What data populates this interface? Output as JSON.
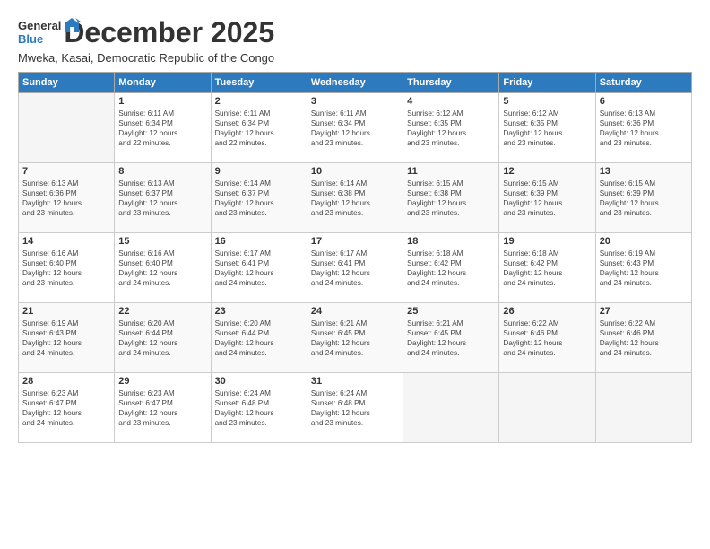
{
  "logo": {
    "line1": "General",
    "line2": "Blue"
  },
  "header": {
    "title": "December 2025",
    "subtitle": "Mweka, Kasai, Democratic Republic of the Congo"
  },
  "days_of_week": [
    "Sunday",
    "Monday",
    "Tuesday",
    "Wednesday",
    "Thursday",
    "Friday",
    "Saturday"
  ],
  "weeks": [
    [
      {
        "day": "",
        "content": ""
      },
      {
        "day": "1",
        "content": "Sunrise: 6:11 AM\nSunset: 6:34 PM\nDaylight: 12 hours\nand 22 minutes."
      },
      {
        "day": "2",
        "content": "Sunrise: 6:11 AM\nSunset: 6:34 PM\nDaylight: 12 hours\nand 22 minutes."
      },
      {
        "day": "3",
        "content": "Sunrise: 6:11 AM\nSunset: 6:34 PM\nDaylight: 12 hours\nand 23 minutes."
      },
      {
        "day": "4",
        "content": "Sunrise: 6:12 AM\nSunset: 6:35 PM\nDaylight: 12 hours\nand 23 minutes."
      },
      {
        "day": "5",
        "content": "Sunrise: 6:12 AM\nSunset: 6:35 PM\nDaylight: 12 hours\nand 23 minutes."
      },
      {
        "day": "6",
        "content": "Sunrise: 6:13 AM\nSunset: 6:36 PM\nDaylight: 12 hours\nand 23 minutes."
      }
    ],
    [
      {
        "day": "7",
        "content": "Sunrise: 6:13 AM\nSunset: 6:36 PM\nDaylight: 12 hours\nand 23 minutes."
      },
      {
        "day": "8",
        "content": "Sunrise: 6:13 AM\nSunset: 6:37 PM\nDaylight: 12 hours\nand 23 minutes."
      },
      {
        "day": "9",
        "content": "Sunrise: 6:14 AM\nSunset: 6:37 PM\nDaylight: 12 hours\nand 23 minutes."
      },
      {
        "day": "10",
        "content": "Sunrise: 6:14 AM\nSunset: 6:38 PM\nDaylight: 12 hours\nand 23 minutes."
      },
      {
        "day": "11",
        "content": "Sunrise: 6:15 AM\nSunset: 6:38 PM\nDaylight: 12 hours\nand 23 minutes."
      },
      {
        "day": "12",
        "content": "Sunrise: 6:15 AM\nSunset: 6:39 PM\nDaylight: 12 hours\nand 23 minutes."
      },
      {
        "day": "13",
        "content": "Sunrise: 6:15 AM\nSunset: 6:39 PM\nDaylight: 12 hours\nand 23 minutes."
      }
    ],
    [
      {
        "day": "14",
        "content": "Sunrise: 6:16 AM\nSunset: 6:40 PM\nDaylight: 12 hours\nand 23 minutes."
      },
      {
        "day": "15",
        "content": "Sunrise: 6:16 AM\nSunset: 6:40 PM\nDaylight: 12 hours\nand 24 minutes."
      },
      {
        "day": "16",
        "content": "Sunrise: 6:17 AM\nSunset: 6:41 PM\nDaylight: 12 hours\nand 24 minutes."
      },
      {
        "day": "17",
        "content": "Sunrise: 6:17 AM\nSunset: 6:41 PM\nDaylight: 12 hours\nand 24 minutes."
      },
      {
        "day": "18",
        "content": "Sunrise: 6:18 AM\nSunset: 6:42 PM\nDaylight: 12 hours\nand 24 minutes."
      },
      {
        "day": "19",
        "content": "Sunrise: 6:18 AM\nSunset: 6:42 PM\nDaylight: 12 hours\nand 24 minutes."
      },
      {
        "day": "20",
        "content": "Sunrise: 6:19 AM\nSunset: 6:43 PM\nDaylight: 12 hours\nand 24 minutes."
      }
    ],
    [
      {
        "day": "21",
        "content": "Sunrise: 6:19 AM\nSunset: 6:43 PM\nDaylight: 12 hours\nand 24 minutes."
      },
      {
        "day": "22",
        "content": "Sunrise: 6:20 AM\nSunset: 6:44 PM\nDaylight: 12 hours\nand 24 minutes."
      },
      {
        "day": "23",
        "content": "Sunrise: 6:20 AM\nSunset: 6:44 PM\nDaylight: 12 hours\nand 24 minutes."
      },
      {
        "day": "24",
        "content": "Sunrise: 6:21 AM\nSunset: 6:45 PM\nDaylight: 12 hours\nand 24 minutes."
      },
      {
        "day": "25",
        "content": "Sunrise: 6:21 AM\nSunset: 6:45 PM\nDaylight: 12 hours\nand 24 minutes."
      },
      {
        "day": "26",
        "content": "Sunrise: 6:22 AM\nSunset: 6:46 PM\nDaylight: 12 hours\nand 24 minutes."
      },
      {
        "day": "27",
        "content": "Sunrise: 6:22 AM\nSunset: 6:46 PM\nDaylight: 12 hours\nand 24 minutes."
      }
    ],
    [
      {
        "day": "28",
        "content": "Sunrise: 6:23 AM\nSunset: 6:47 PM\nDaylight: 12 hours\nand 24 minutes."
      },
      {
        "day": "29",
        "content": "Sunrise: 6:23 AM\nSunset: 6:47 PM\nDaylight: 12 hours\nand 23 minutes."
      },
      {
        "day": "30",
        "content": "Sunrise: 6:24 AM\nSunset: 6:48 PM\nDaylight: 12 hours\nand 23 minutes."
      },
      {
        "day": "31",
        "content": "Sunrise: 6:24 AM\nSunset: 6:48 PM\nDaylight: 12 hours\nand 23 minutes."
      },
      {
        "day": "",
        "content": ""
      },
      {
        "day": "",
        "content": ""
      },
      {
        "day": "",
        "content": ""
      }
    ]
  ]
}
